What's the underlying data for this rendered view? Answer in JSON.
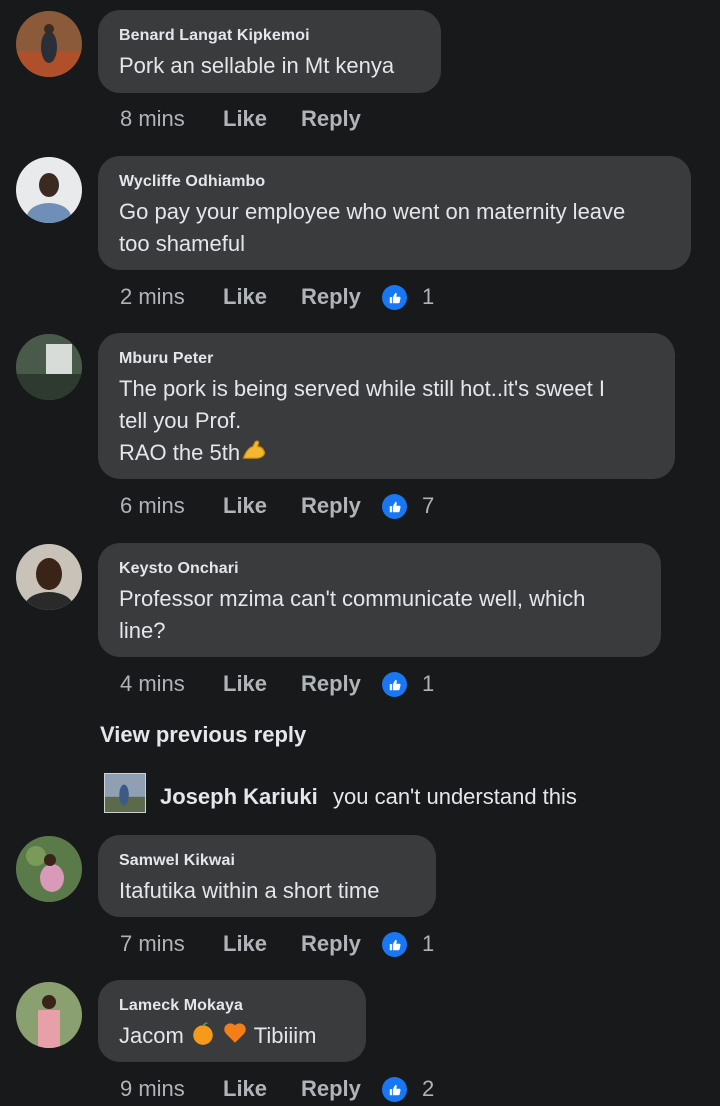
{
  "comments": [
    {
      "author": "Benard Langat Kipkemoi",
      "text_lines": [
        "Pork an sellable in Mt kenya"
      ],
      "time": "8 mins",
      "like_label": "Like",
      "reply_label": "Reply",
      "reactions": null
    },
    {
      "author": "Wycliffe Odhiambo",
      "text_lines": [
        "Go pay your employee who went on maternity leave",
        "too shameful"
      ],
      "time": "2 mins",
      "like_label": "Like",
      "reply_label": "Reply",
      "reactions": "1"
    },
    {
      "author": "Mburu Peter",
      "text_lines": [
        "The pork is being served while still hot..it's sweet I",
        "tell you Prof.",
        "RAO the 5th"
      ],
      "time": "6 mins",
      "like_label": "Like",
      "reply_label": "Reply",
      "reactions": "7"
    },
    {
      "author": "Keysto Onchari",
      "text_lines": [
        "Professor mzima can't communicate well, which",
        "line?"
      ],
      "time": "4 mins",
      "like_label": "Like",
      "reply_label": "Reply",
      "reactions": "1"
    },
    {
      "author": "Samwel Kikwai",
      "text_lines": [
        "Itafutika within a short time"
      ],
      "time": "7 mins",
      "like_label": "Like",
      "reply_label": "Reply",
      "reactions": "1"
    },
    {
      "author": "Lameck Mokaya",
      "text_parts": [
        "Jacom",
        "Tibiiim"
      ],
      "time": "9 mins",
      "like_label": "Like",
      "reply_label": "Reply",
      "reactions": "2"
    }
  ],
  "view_previous": "View previous reply",
  "nested_reply": {
    "author": "Joseph Kariuki",
    "text": "you can't understand this"
  },
  "colors": {
    "background": "#18191a",
    "bubble": "#3a3b3c",
    "like_blue": "#1877f2",
    "meta_text": "#b0b3b8"
  },
  "icons": [
    "like-reaction-icon",
    "flexed-biceps-emoji",
    "tangerine-emoji",
    "orange-heart-emoji"
  ]
}
